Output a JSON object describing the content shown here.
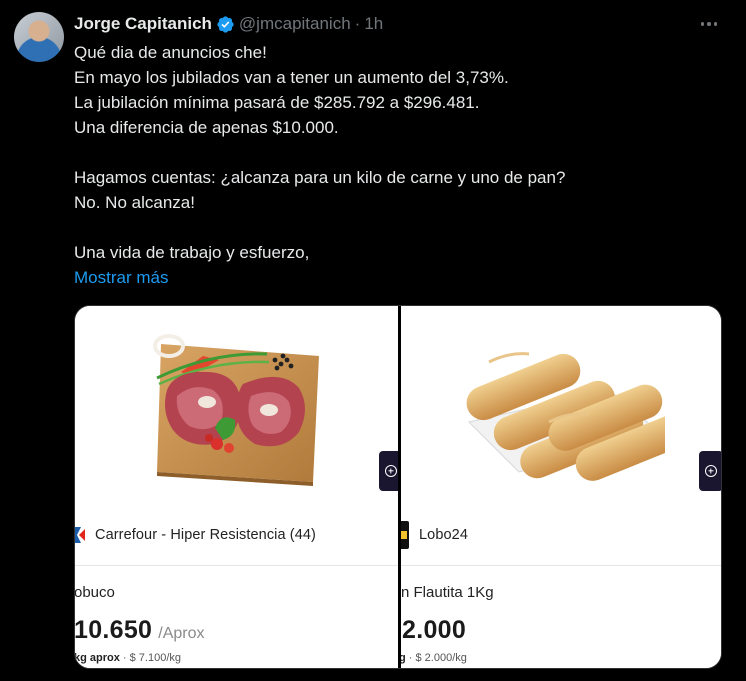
{
  "author": {
    "display_name": "Jorge Capitanich",
    "handle": "@jmcapitanich",
    "separator": "·",
    "time": "1h",
    "verified_icon": "verified-badge-icon"
  },
  "tweet": {
    "lines_block1": [
      "Qué dia de anuncios che!",
      "En mayo los jubilados van a tener un aumento del 3,73%.",
      "La jubilación mínima pasará de $285.792 a $296.481.",
      "Una diferencia de apenas $10.000."
    ],
    "lines_block2": [
      "Hagamos cuentas: ¿alcanza para un kilo de carne y uno de pan?",
      "No. No alcanza!"
    ],
    "lines_block3": [
      "Una vida de trabajo y esfuerzo,"
    ],
    "show_more": "Mostrar más"
  },
  "media": {
    "left": {
      "store": "Carrefour - Hiper Resistencia (44)",
      "product": "obuco",
      "price": "10.650",
      "unit": "/Aprox",
      "sub_strong": "kg aprox",
      "sub_rest": " · $ 7.100/kg"
    },
    "right": {
      "store": "Lobo24",
      "product": "n Flautita 1Kg",
      "price": "2.000",
      "sub_strong": "g",
      "sub_rest": " · $ 2.000/kg"
    }
  },
  "colors": {
    "background": "#000000",
    "text": "#e7e9ea",
    "muted": "#71767b",
    "link": "#1d9bf0",
    "verified": "#1d9bf0"
  }
}
